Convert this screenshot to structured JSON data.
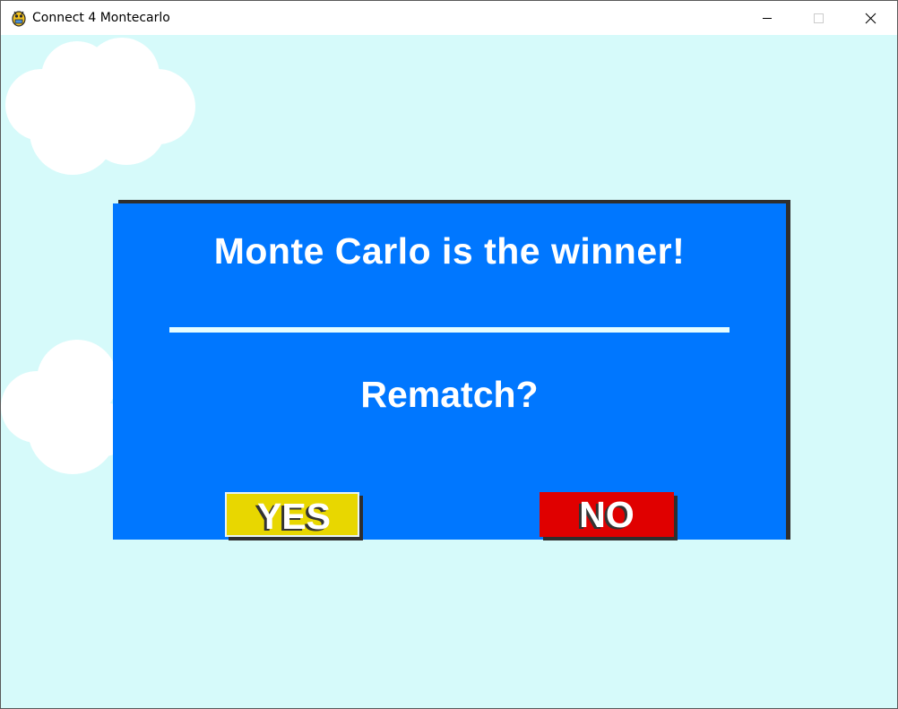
{
  "window": {
    "title": "Connect 4 Montecarlo",
    "app_icon": "pygame-snake-icon",
    "controls": {
      "minimize_icon": "minimize-icon",
      "maximize_icon": "maximize-icon",
      "close_icon": "close-icon"
    }
  },
  "colors": {
    "sky": "#d6fafa",
    "dialog": "#0077ff",
    "yes_button": "#e8d700",
    "no_button": "#e00000",
    "shadow": "#2e2e2e",
    "text": "#ffffff"
  },
  "dialog": {
    "winner_message": "Monte Carlo is the winner!",
    "rematch_prompt": "Rematch?",
    "yes_label": "YES",
    "no_label": "NO"
  }
}
